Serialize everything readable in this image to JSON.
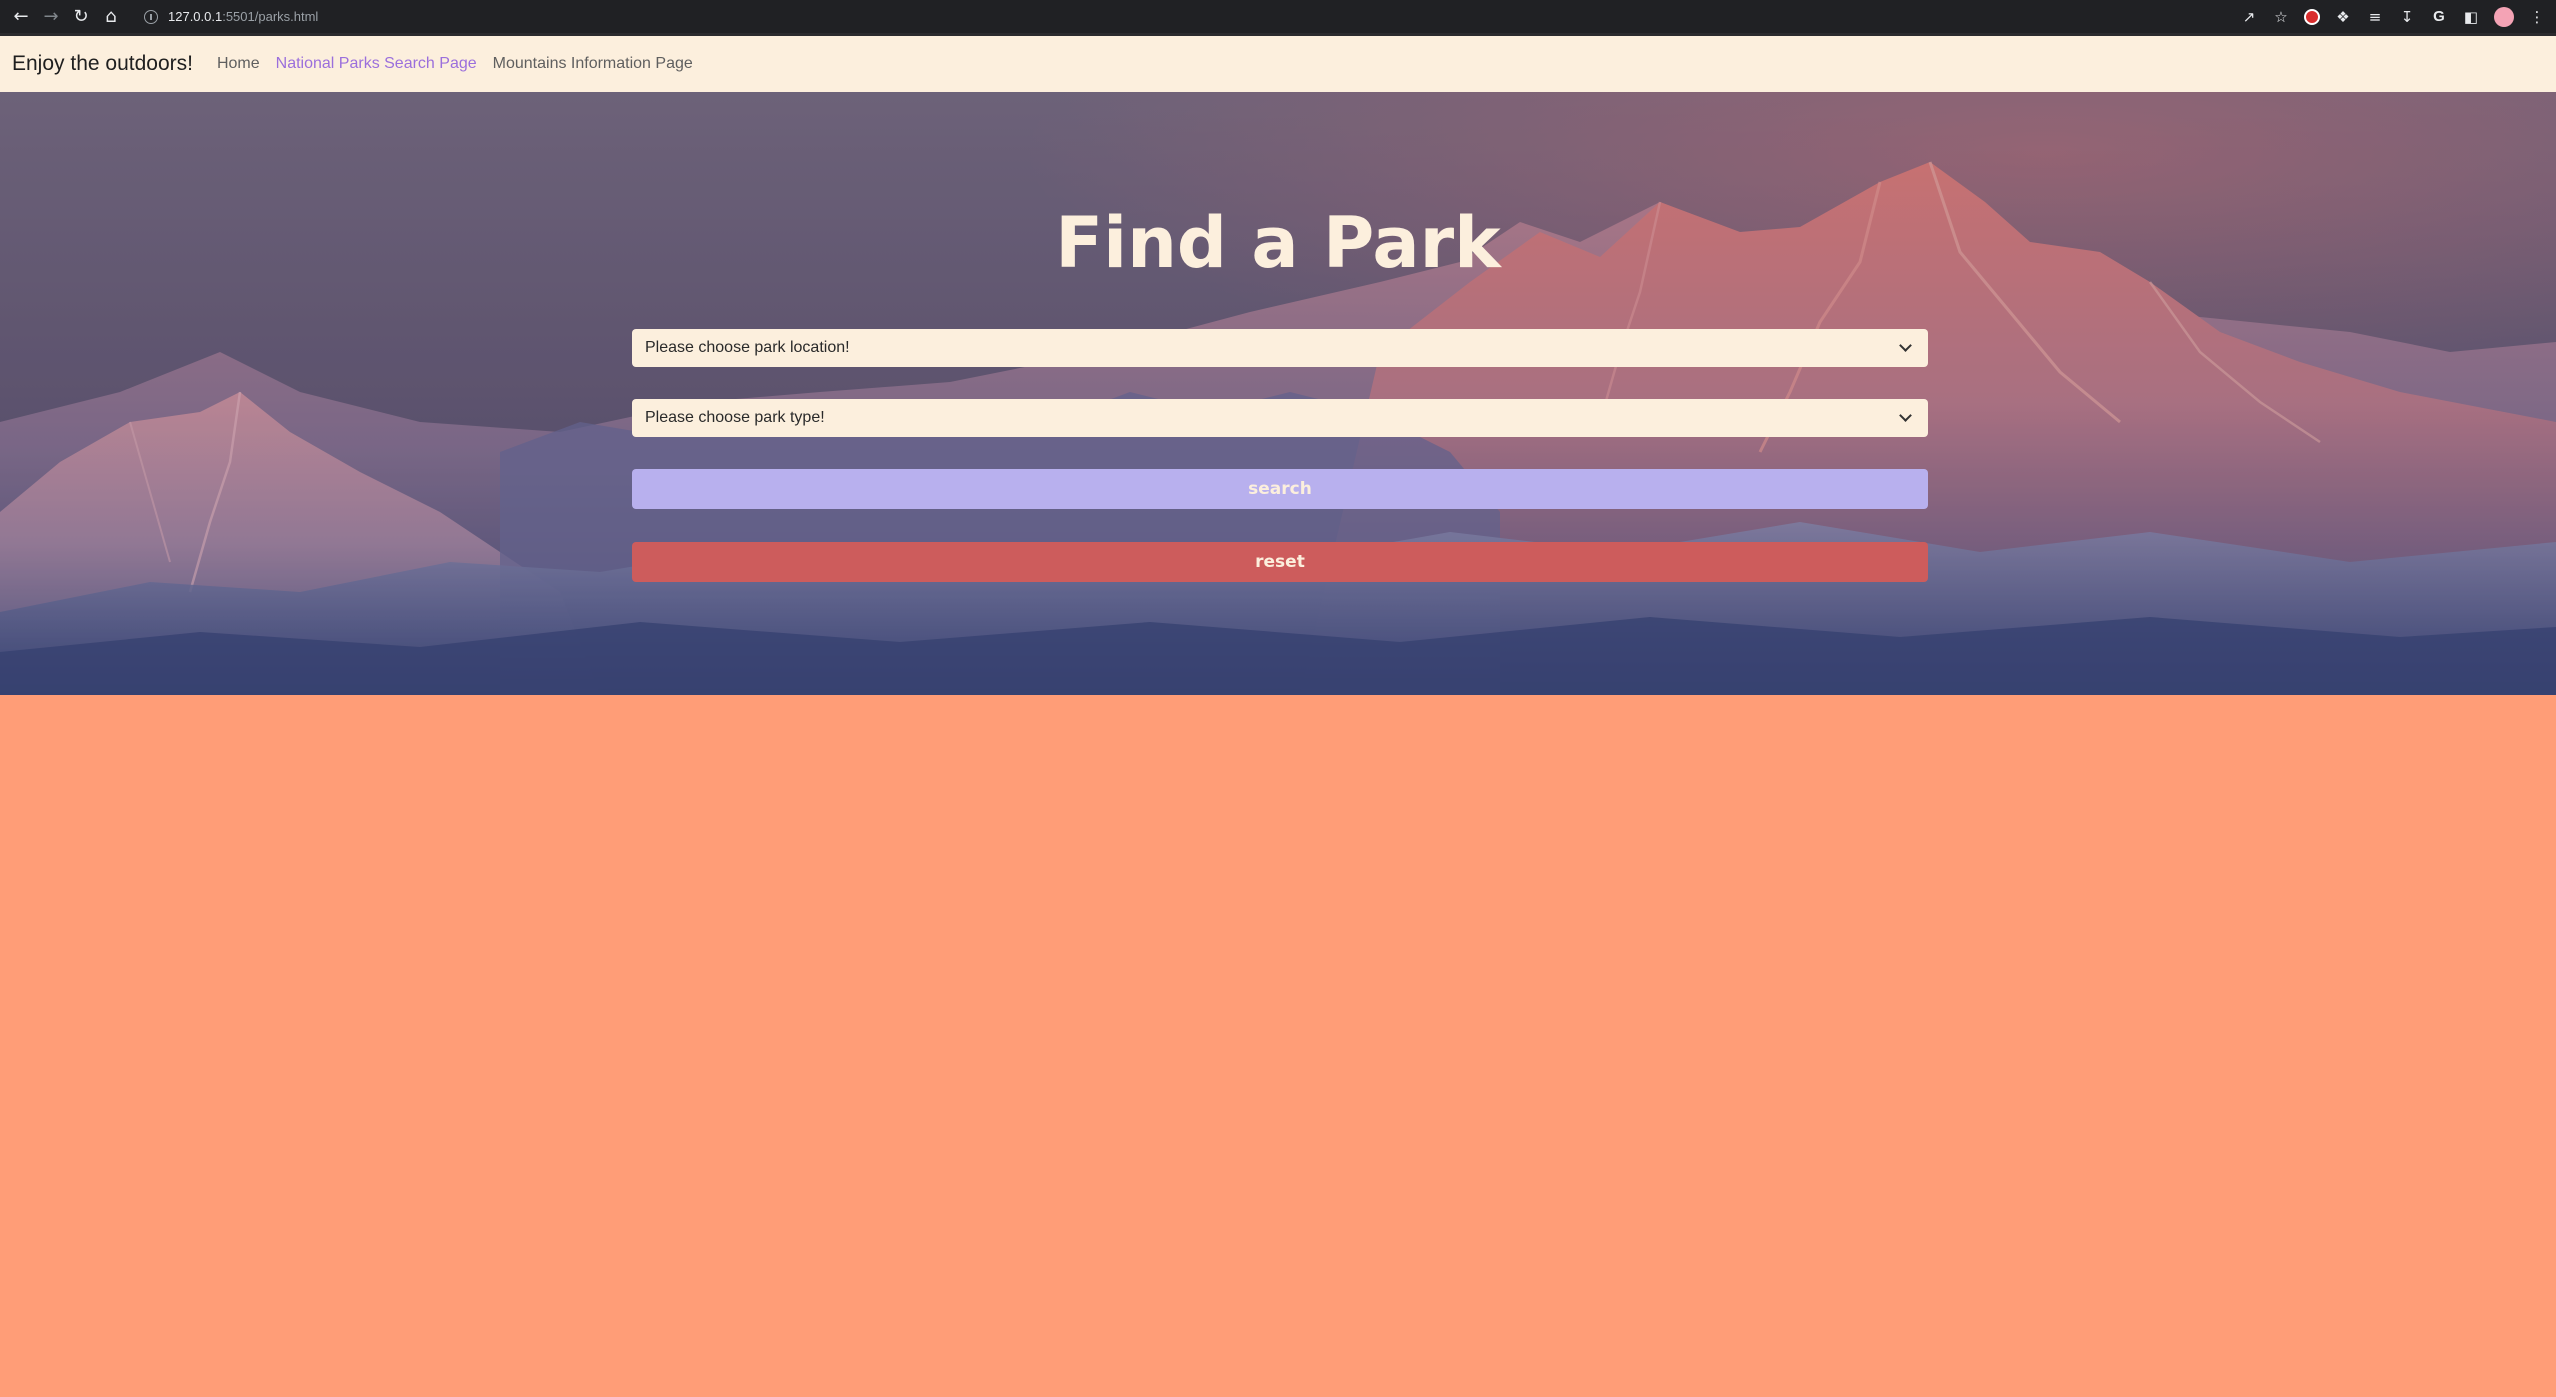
{
  "browser": {
    "url_host": "127.0.0.1",
    "url_path": ":5501/parks.html",
    "icons": [
      "back-arrow-icon",
      "forward-arrow-icon",
      "reload-icon",
      "home-icon",
      "site-info-icon",
      "share-icon",
      "star-icon",
      "extension-icon",
      "puzzle-icon",
      "reading-list-icon",
      "download-icon",
      "google-icon",
      "sidebar-icon",
      "profile-avatar",
      "kebab-menu-icon"
    ]
  },
  "navbar": {
    "brand": "Enjoy the outdoors!",
    "links": [
      {
        "label": "Home"
      },
      {
        "label": "National Parks Search Page",
        "active": true
      },
      {
        "label": "Mountains Information Page"
      }
    ]
  },
  "hero": {
    "title": "Find a Park",
    "location_select": "Please choose park location!",
    "type_select": "Please choose park type!",
    "search_label": "search",
    "reset_label": "reset"
  },
  "colors": {
    "page_background": "#ff9d77",
    "navbar_background": "#fcefdd",
    "active_link": "#9b6fdc",
    "search_button": "#b8b0ee",
    "reset_button": "#cd5c5c",
    "title_text": "#fcefdd"
  }
}
